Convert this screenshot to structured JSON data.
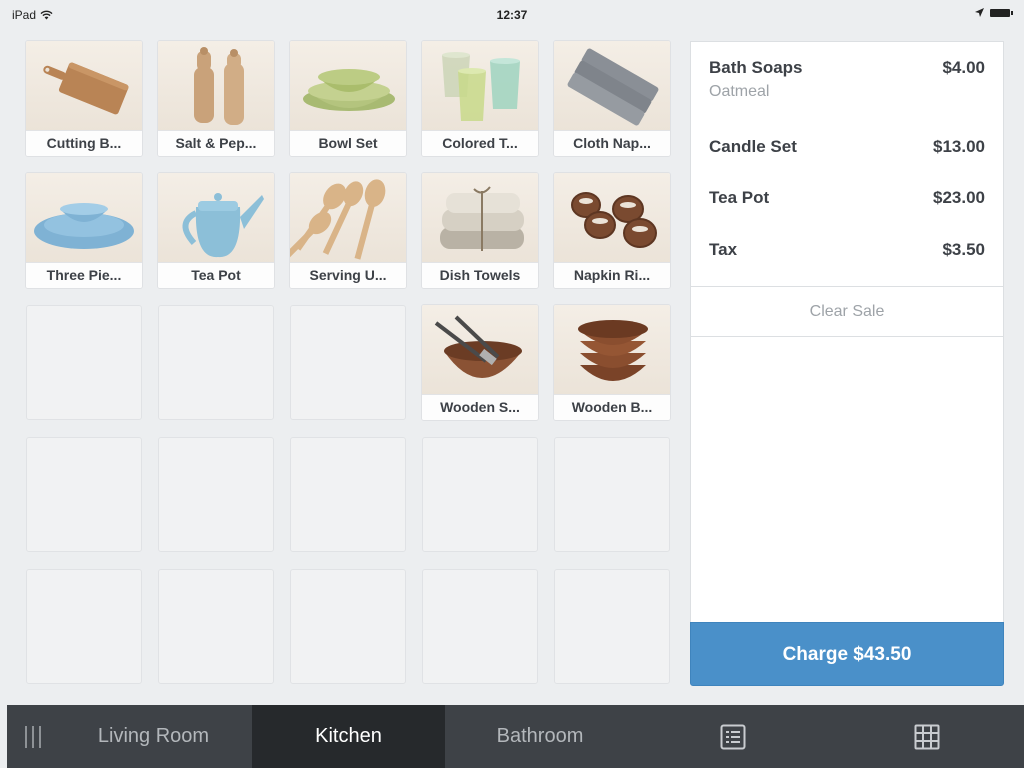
{
  "status_bar": {
    "device": "iPad",
    "time": "12:37"
  },
  "items": [
    {
      "label": "Cutting B...",
      "icon": "cutting-board"
    },
    {
      "label": "Salt & Pep...",
      "icon": "salt-pepper"
    },
    {
      "label": "Bowl Set",
      "icon": "bowl-set"
    },
    {
      "label": "Colored T...",
      "icon": "colored-tumblers"
    },
    {
      "label": "Cloth Nap...",
      "icon": "cloth-napkins"
    },
    {
      "label": "Three Pie...",
      "icon": "three-piece-set"
    },
    {
      "label": "Tea Pot",
      "icon": "tea-pot"
    },
    {
      "label": "Serving U...",
      "icon": "serving-utensils"
    },
    {
      "label": "Dish Towels",
      "icon": "dish-towels"
    },
    {
      "label": "Napkin Ri...",
      "icon": "napkin-rings"
    },
    {
      "label": "Wooden S...",
      "icon": "wooden-salad-bowl"
    },
    {
      "label": "Wooden B...",
      "icon": "wooden-bowls"
    }
  ],
  "sale": {
    "lines": [
      {
        "name": "Bath Soaps",
        "variant": "Oatmeal",
        "price": "$4.00"
      },
      {
        "name": "Candle Set",
        "price": "$13.00"
      },
      {
        "name": "Tea Pot",
        "price": "$23.00"
      },
      {
        "name": "Tax",
        "price": "$3.50"
      }
    ],
    "clear_label": "Clear Sale",
    "charge_label": "Charge $43.50"
  },
  "tabs": [
    {
      "label": "Living Room",
      "active": false
    },
    {
      "label": "Kitchen",
      "active": true
    },
    {
      "label": "Bathroom",
      "active": false
    }
  ],
  "tab_icons": [
    "list-icon",
    "grid-icon"
  ],
  "colors": {
    "charge_button": "#4a90c9",
    "tab_bar": "#3e4247",
    "tab_active": "#26292c"
  }
}
